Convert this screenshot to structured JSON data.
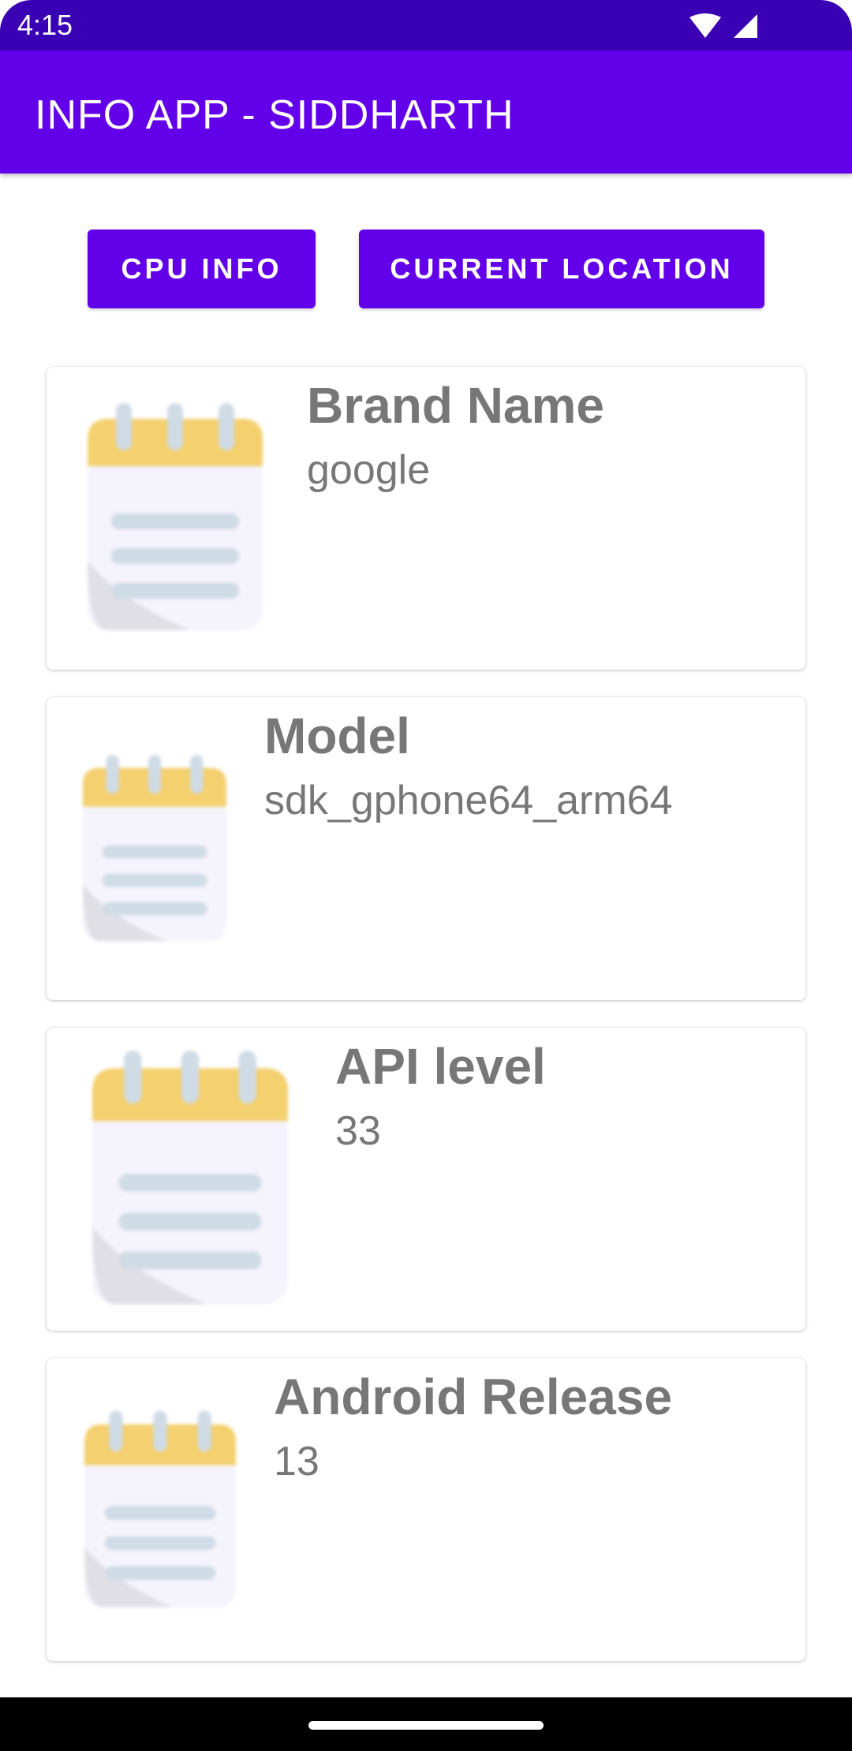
{
  "status_bar": {
    "time": "4:15",
    "icons": [
      "wifi-icon",
      "cell-signal-icon"
    ]
  },
  "app_bar": {
    "title": "INFO APP - SIDDHARTH"
  },
  "buttons": {
    "cpu_info": "CPU INFO",
    "current_location": "CURRENT LOCATION"
  },
  "cards": [
    {
      "label": "Brand Name",
      "value": "google",
      "icon": "notepad-icon"
    },
    {
      "label": "Model",
      "value": "sdk_gphone64_arm64",
      "icon": "notepad-icon"
    },
    {
      "label": "API level",
      "value": "33",
      "icon": "notepad-icon"
    },
    {
      "label": "Android Release",
      "value": "13",
      "icon": "notepad-icon"
    }
  ],
  "colors": {
    "primary": "#6200ea",
    "status_bar": "#3a00b3",
    "card_text": "#777777",
    "notepad_top": "#f4d06f",
    "notepad_body": "#f5f3fb",
    "notepad_lines": "#cfdbe5"
  }
}
